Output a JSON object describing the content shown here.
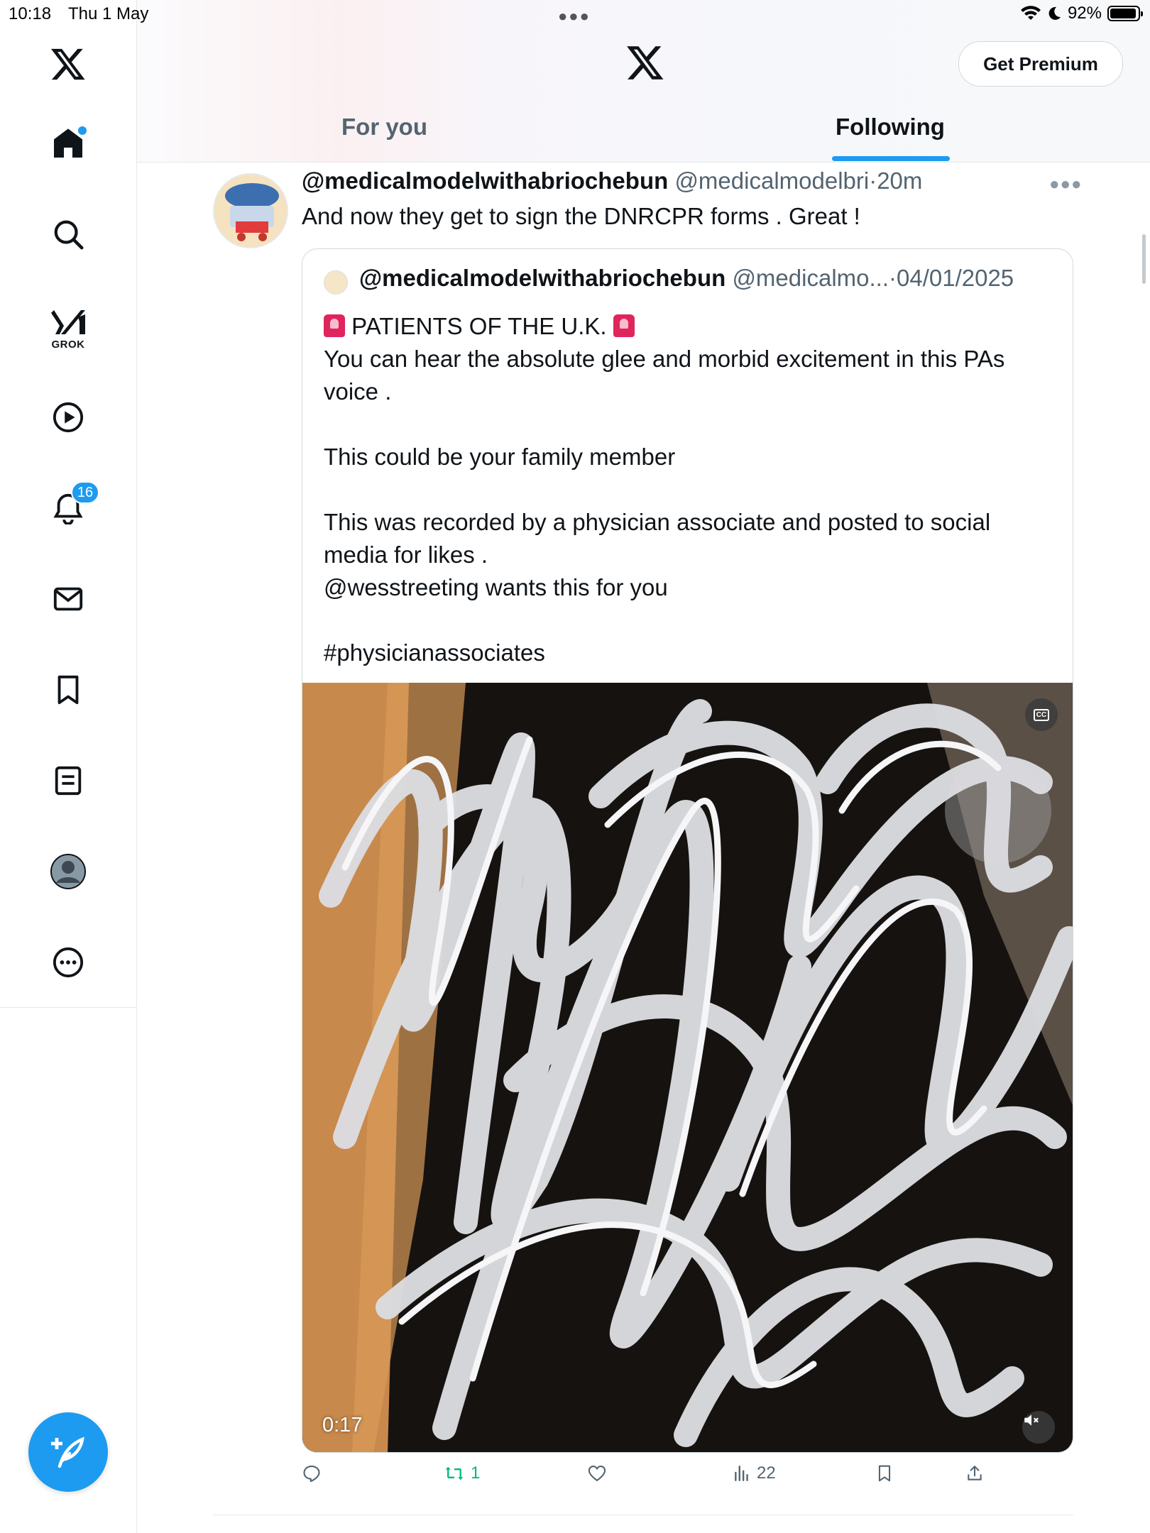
{
  "status_bar": {
    "time": "10:18",
    "date": "Thu 1 May",
    "battery": "92%",
    "battery_level": 0.92,
    "icons": [
      "wifi-icon",
      "moon-icon",
      "battery-icon"
    ]
  },
  "sidebar": {
    "items": [
      {
        "name": "x-logo-icon"
      },
      {
        "name": "home-icon",
        "has_dot": true
      },
      {
        "name": "search-icon"
      },
      {
        "name": "grok-icon",
        "label": "GROK"
      },
      {
        "name": "video-icon"
      },
      {
        "name": "notifications-icon",
        "badge": "16"
      },
      {
        "name": "messages-icon"
      },
      {
        "name": "bookmarks-icon"
      },
      {
        "name": "lists-icon"
      },
      {
        "name": "profile-avatar-icon"
      },
      {
        "name": "more-icon"
      }
    ],
    "compose_icon": "compose-icon"
  },
  "header": {
    "premium_label": "Get Premium",
    "tabs": [
      {
        "label": "For you",
        "active": false
      },
      {
        "label": "Following",
        "active": true
      }
    ]
  },
  "post": {
    "display_name": "@medicalmodelwithabriochebun",
    "handle": "@medicalmodelbri",
    "separator": "·",
    "time": "20m",
    "text": "And now they get to sign the DNRCPR forms . Great !",
    "quote": {
      "display_name": "@medicalmodelwithabriochebun",
      "handle": "@medicalmo...",
      "separator": "·",
      "date": "04/01/2025",
      "line1": "PATIENTS OF THE U.K.",
      "line2": "You can hear the absolute glee and morbid excitement in this PAs voice .",
      "line3": "This could be your family member",
      "line4": "This was recorded by a physician associate and posted to social media for likes .",
      "line5": "@wesstreeting wants this for you",
      "line6": "#physicianassociates",
      "video": {
        "duration": "0:17",
        "cc_label": "CC"
      }
    },
    "actions": {
      "reposts": "1",
      "views": "22"
    }
  },
  "colors": {
    "accent": "#1d9bf0",
    "repost": "#00ba7c",
    "secondary_text": "#536471"
  }
}
